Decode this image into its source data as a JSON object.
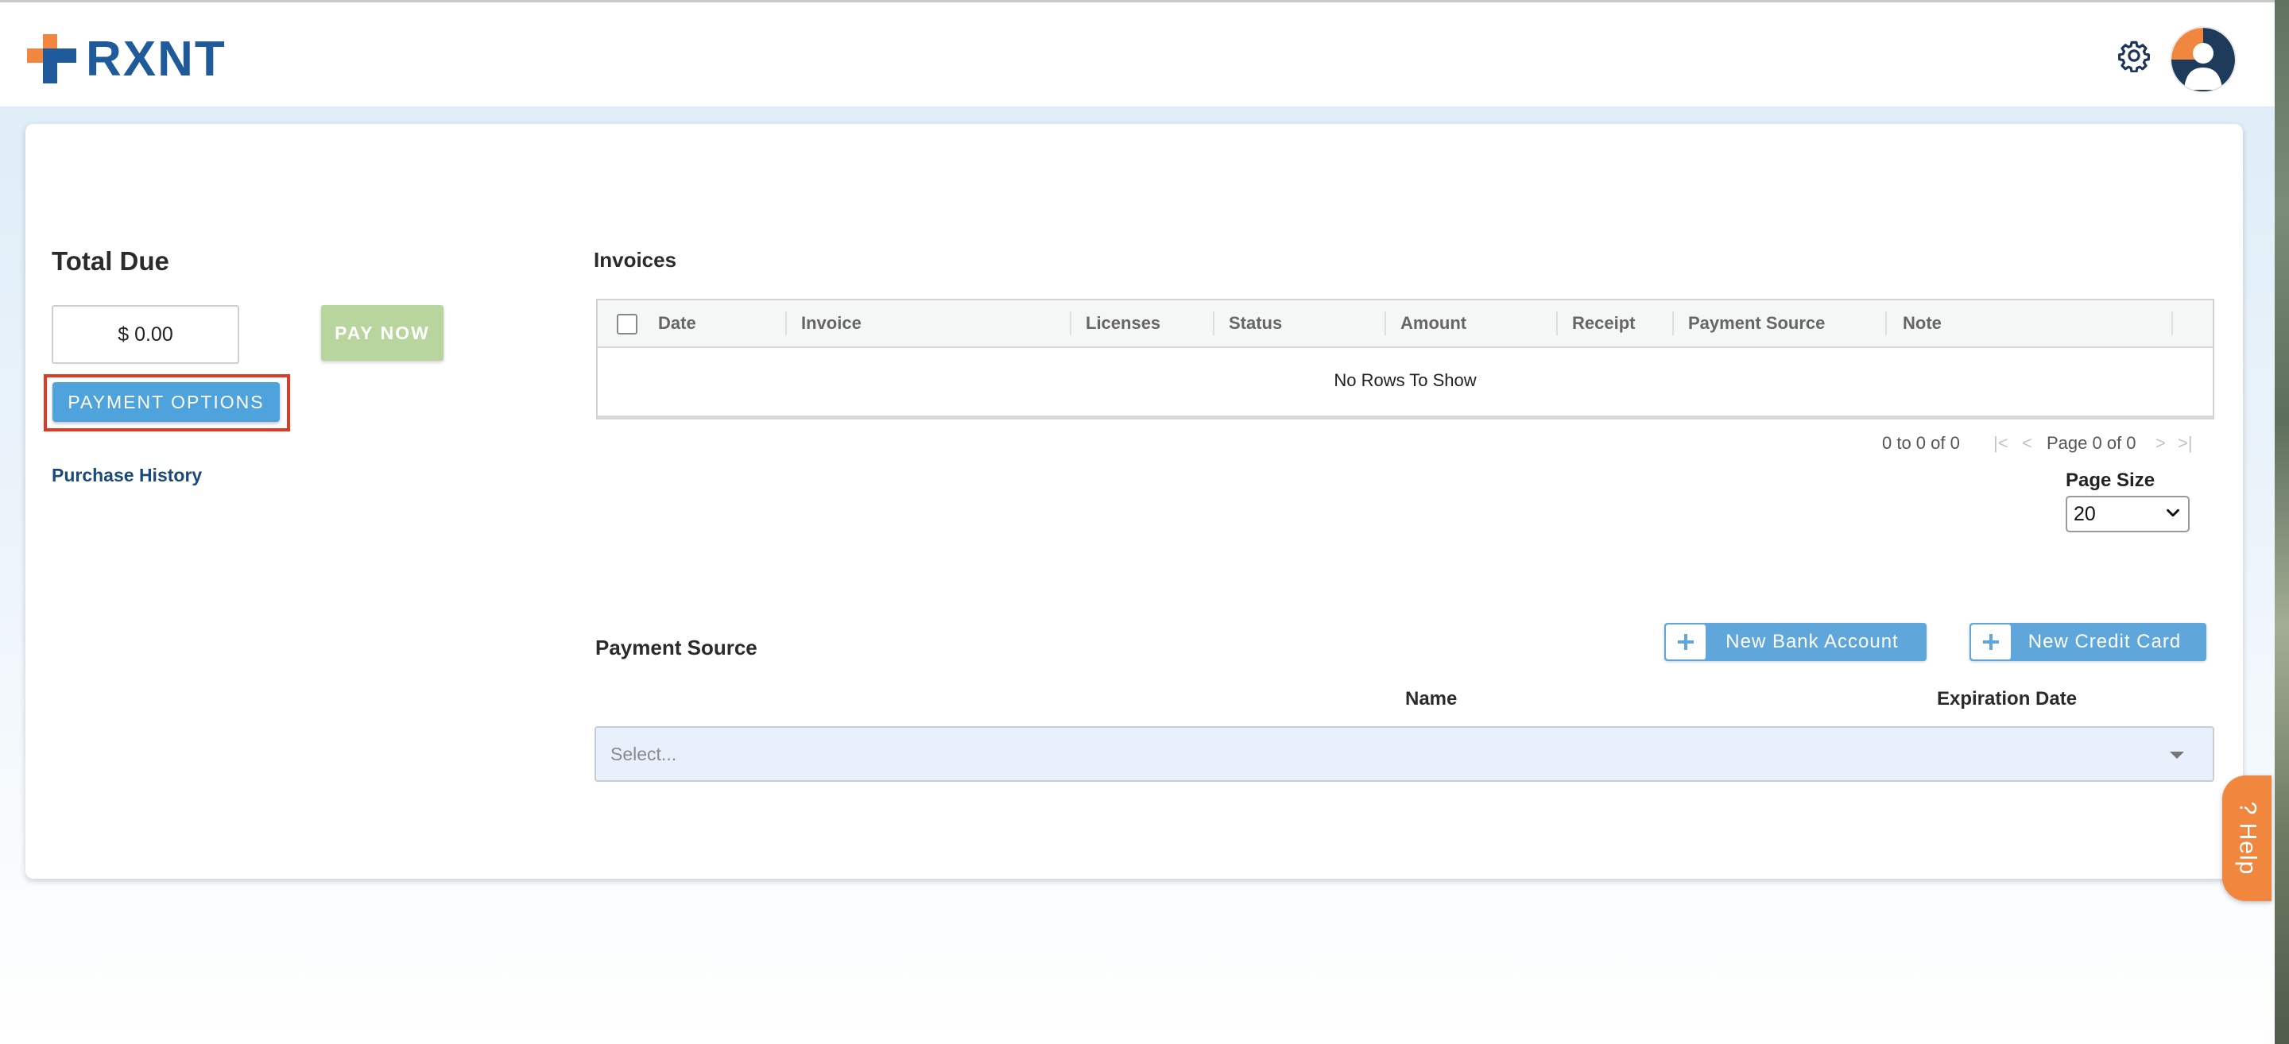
{
  "header": {
    "logo_text": "RXNT",
    "colors": {
      "logo_orange": "#f1873f",
      "logo_blue": "#1f5b9b"
    },
    "icons": [
      "gear-icon",
      "user-avatar-icon"
    ]
  },
  "left": {
    "total_due_label": "Total Due",
    "amount_value": "$ 0.00",
    "pay_now_label": "PAY NOW",
    "payment_options_label": "PAYMENT OPTIONS",
    "purchase_history_label": "Purchase History"
  },
  "invoices": {
    "title": "Invoices",
    "columns": [
      "Date",
      "Invoice",
      "Licenses",
      "Status",
      "Amount",
      "Receipt",
      "Payment Source",
      "Note"
    ],
    "empty_text": "No Rows To Show",
    "pager": {
      "range_text": "0 to 0 of 0",
      "page_text": "Page 0 of 0"
    },
    "page_size_label": "Page Size",
    "page_size_value": "20"
  },
  "payment_source": {
    "title": "Payment Source",
    "new_bank_label": "New Bank Account",
    "new_card_label": "New Credit Card",
    "col_name": "Name",
    "col_expiration": "Expiration Date",
    "select_placeholder": "Select..."
  },
  "help": {
    "label": "? Help"
  }
}
